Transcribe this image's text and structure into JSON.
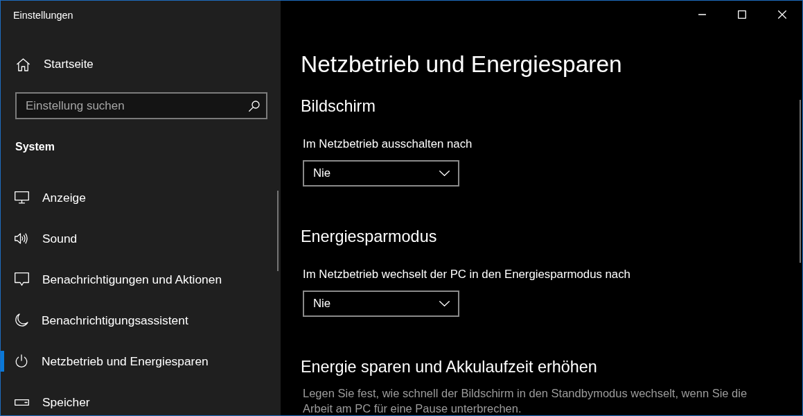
{
  "window": {
    "title": "Einstellungen"
  },
  "sidebar": {
    "home": {
      "label": "Startseite"
    },
    "search": {
      "placeholder": "Einstellung suchen"
    },
    "section": "System",
    "items": [
      {
        "label": "Anzeige",
        "selected": false
      },
      {
        "label": "Sound",
        "selected": false
      },
      {
        "label": "Benachrichtigungen und Aktionen",
        "selected": false
      },
      {
        "label": "Benachrichtigungsassistent",
        "selected": false
      },
      {
        "label": "Netzbetrieb und Energiesparen",
        "selected": true
      },
      {
        "label": "Speicher",
        "selected": false
      }
    ]
  },
  "content": {
    "title": "Netzbetrieb und Energiesparen",
    "sections": [
      {
        "heading": "Bildschirm",
        "settings": [
          {
            "label": "Im Netzbetrieb ausschalten nach",
            "value": "Nie"
          }
        ]
      },
      {
        "heading": "Energiesparmodus",
        "settings": [
          {
            "label": "Im Netzbetrieb wechselt der PC in den Energiesparmodus nach",
            "value": "Nie"
          }
        ]
      },
      {
        "heading": "Energie sparen und Akkulaufzeit erhöhen",
        "description": "Legen Sie fest, wie schnell der Bildschirm in den Standbymodus wechselt, wenn Sie die Arbeit am PC für eine Pause unterbrechen."
      }
    ]
  }
}
